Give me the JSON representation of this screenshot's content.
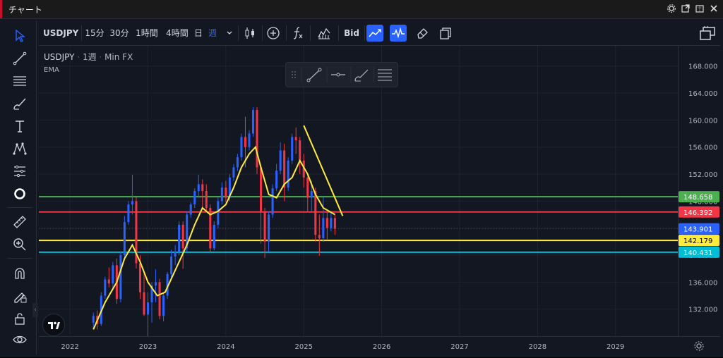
{
  "window": {
    "title": "チャート"
  },
  "toolbar": {
    "symbol": "USDJPY",
    "intervals": [
      "15分",
      "30分",
      "1時間",
      "4時間",
      "日",
      "週"
    ],
    "active_interval": "週",
    "price_source": "Bid"
  },
  "legend": {
    "symbol": "USDJPY",
    "interval": "1週",
    "source": "Min FX",
    "indicator": "EMA"
  },
  "price_axis": {
    "ticks": [
      "168.000",
      "164.000",
      "160.000",
      "156.000",
      "152.000",
      "148.000",
      "144.000",
      "140.000",
      "136.000",
      "132.000"
    ],
    "badges": [
      {
        "label": "148.658",
        "color": "#4caf50",
        "text_color": "#ffffff"
      },
      {
        "label": "146.392",
        "color": "#f23645",
        "text_color": "#ffffff"
      },
      {
        "label": "143.901",
        "color": "#2962ff",
        "text_color": "#ffffff"
      },
      {
        "label": "142.179",
        "color": "#ffeb3b",
        "text_color": "#000000"
      },
      {
        "label": "140.431",
        "color": "#00bcd4",
        "text_color": "#ffffff"
      }
    ]
  },
  "time_axis": {
    "labels": [
      "2022",
      "2023",
      "2024",
      "2025",
      "2026",
      "2027",
      "2028",
      "2029"
    ]
  },
  "chart_data": {
    "type": "candlestick",
    "ylim": [
      128,
      171
    ],
    "xlim": [
      2021.6,
      2029.8
    ],
    "ohlc_weekly": [
      [
        2022.3,
        130.0,
        131.5,
        129.2,
        131.0
      ],
      [
        2022.35,
        131.0,
        131.8,
        129.0,
        129.8
      ],
      [
        2022.4,
        129.8,
        134.5,
        129.5,
        134.0
      ],
      [
        2022.45,
        134.0,
        136.8,
        133.5,
        136.4
      ],
      [
        2022.5,
        136.4,
        138.2,
        135.2,
        135.8
      ],
      [
        2022.55,
        135.8,
        139.0,
        135.0,
        138.5
      ],
      [
        2022.6,
        138.5,
        139.5,
        132.8,
        133.5
      ],
      [
        2022.65,
        133.5,
        140.5,
        133.0,
        140.0
      ],
      [
        2022.7,
        140.0,
        145.8,
        139.5,
        144.9
      ],
      [
        2022.75,
        144.9,
        148.0,
        144.5,
        147.5
      ],
      [
        2022.8,
        147.5,
        151.9,
        146.0,
        148.0
      ],
      [
        2022.85,
        148.0,
        148.6,
        138.0,
        138.8
      ],
      [
        2022.9,
        138.8,
        140.0,
        133.5,
        134.5
      ],
      [
        2022.95,
        134.5,
        137.5,
        131.0,
        131.2
      ],
      [
        2023.0,
        131.2,
        134.5,
        127.2,
        133.0
      ],
      [
        2023.05,
        133.0,
        136.0,
        130.0,
        135.5
      ],
      [
        2023.1,
        135.5,
        137.9,
        133.0,
        136.0
      ],
      [
        2023.15,
        136.0,
        136.5,
        130.5,
        131.0
      ],
      [
        2023.2,
        131.0,
        134.5,
        130.2,
        134.0
      ],
      [
        2023.25,
        134.0,
        137.5,
        133.5,
        137.2
      ],
      [
        2023.3,
        137.2,
        140.8,
        136.5,
        139.8
      ],
      [
        2023.35,
        139.8,
        141.5,
        138.5,
        140.5
      ],
      [
        2023.4,
        140.5,
        145.0,
        140.0,
        144.5
      ],
      [
        2023.45,
        144.5,
        145.0,
        138.0,
        141.0
      ],
      [
        2023.5,
        141.0,
        146.5,
        140.5,
        146.0
      ],
      [
        2023.55,
        146.0,
        147.8,
        145.5,
        147.5
      ],
      [
        2023.6,
        147.5,
        149.9,
        147.0,
        149.5
      ],
      [
        2023.65,
        149.5,
        151.9,
        148.5,
        150.5
      ],
      [
        2023.7,
        150.5,
        151.2,
        147.0,
        149.5
      ],
      [
        2023.75,
        149.5,
        150.5,
        146.5,
        147.0
      ],
      [
        2023.8,
        147.0,
        147.5,
        140.5,
        141.0
      ],
      [
        2023.85,
        141.0,
        145.0,
        140.7,
        144.5
      ],
      [
        2023.9,
        144.5,
        148.5,
        144.0,
        148.0
      ],
      [
        2023.95,
        148.0,
        150.8,
        147.5,
        150.0
      ],
      [
        2024.0,
        150.0,
        151.0,
        147.8,
        148.5
      ],
      [
        2024.05,
        148.5,
        152.0,
        148.0,
        151.5
      ],
      [
        2024.1,
        151.5,
        153.5,
        151.0,
        153.0
      ],
      [
        2024.15,
        153.0,
        155.0,
        152.5,
        154.5
      ],
      [
        2024.2,
        154.5,
        158.0,
        154.0,
        157.5
      ],
      [
        2024.25,
        157.5,
        160.5,
        153.0,
        156.0
      ],
      [
        2024.3,
        156.0,
        158.5,
        155.5,
        158.0
      ],
      [
        2024.35,
        158.0,
        161.9,
        157.5,
        161.5
      ],
      [
        2024.4,
        161.5,
        161.9,
        152.0,
        153.0
      ],
      [
        2024.45,
        153.0,
        153.5,
        141.7,
        146.5
      ],
      [
        2024.5,
        146.5,
        147.0,
        139.6,
        142.0
      ],
      [
        2024.55,
        142.0,
        146.5,
        140.5,
        146.0
      ],
      [
        2024.6,
        146.0,
        150.5,
        145.5,
        149.9
      ],
      [
        2024.65,
        149.9,
        153.5,
        149.5,
        152.5
      ],
      [
        2024.7,
        152.5,
        156.7,
        152.0,
        155.5
      ],
      [
        2024.75,
        155.5,
        156.5,
        148.0,
        150.0
      ],
      [
        2024.8,
        150.0,
        154.5,
        149.5,
        154.0
      ],
      [
        2024.85,
        154.0,
        158.0,
        153.5,
        157.5
      ],
      [
        2024.9,
        157.5,
        158.9,
        155.0,
        157.0
      ],
      [
        2024.95,
        157.0,
        157.5,
        152.0,
        154.0
      ],
      [
        2025.0,
        154.0,
        155.0,
        150.0,
        151.5
      ],
      [
        2025.05,
        151.5,
        152.0,
        146.5,
        148.5
      ],
      [
        2025.1,
        148.5,
        151.0,
        146.5,
        149.5
      ],
      [
        2025.15,
        149.5,
        150.0,
        142.0,
        143.0
      ],
      [
        2025.2,
        143.0,
        146.0,
        139.9,
        142.5
      ],
      [
        2025.25,
        142.5,
        148.6,
        142.0,
        145.5
      ],
      [
        2025.3,
        145.5,
        146.5,
        142.2,
        144.0
      ],
      [
        2025.35,
        144.0,
        146.3,
        143.5,
        145.5
      ],
      [
        2025.4,
        145.5,
        146.0,
        143.0,
        143.9
      ]
    ],
    "ema": {
      "name": "EMA",
      "color": "#ffeb3b",
      "points": [
        [
          2022.3,
          129.0
        ],
        [
          2022.45,
          133.0
        ],
        [
          2022.6,
          136.0
        ],
        [
          2022.7,
          139.5
        ],
        [
          2022.8,
          141.5
        ],
        [
          2022.9,
          139.0
        ],
        [
          2023.0,
          136.0
        ],
        [
          2023.12,
          134.0
        ],
        [
          2023.22,
          134.5
        ],
        [
          2023.3,
          136.5
        ],
        [
          2023.4,
          139.0
        ],
        [
          2023.5,
          141.5
        ],
        [
          2023.6,
          144.5
        ],
        [
          2023.7,
          147.0
        ],
        [
          2023.8,
          146.0
        ],
        [
          2023.9,
          146.5
        ],
        [
          2024.0,
          147.5
        ],
        [
          2024.1,
          150.0
        ],
        [
          2024.2,
          153.0
        ],
        [
          2024.3,
          155.0
        ],
        [
          2024.38,
          156.0
        ],
        [
          2024.45,
          153.0
        ],
        [
          2024.55,
          149.0
        ],
        [
          2024.65,
          148.5
        ],
        [
          2024.75,
          150.5
        ],
        [
          2024.85,
          151.5
        ],
        [
          2024.95,
          154.0
        ],
        [
          2025.05,
          152.0
        ],
        [
          2025.15,
          149.0
        ],
        [
          2025.25,
          147.0
        ],
        [
          2025.4,
          146.0
        ]
      ]
    },
    "trendline": {
      "color": "#ffeb3b",
      "from": [
        2025.0,
        159.2
      ],
      "to": [
        2025.5,
        145.8
      ]
    },
    "horizontal_lines": [
      {
        "value": 148.658,
        "color": "#4caf50"
      },
      {
        "value": 146.392,
        "color": "#f23645"
      },
      {
        "value": 142.179,
        "color": "#ffeb3b"
      },
      {
        "value": 140.431,
        "color": "#00bcd4"
      }
    ],
    "last_price": 143.901,
    "candle_colors": {
      "up": "#2962ff",
      "down": "#f23645"
    }
  }
}
